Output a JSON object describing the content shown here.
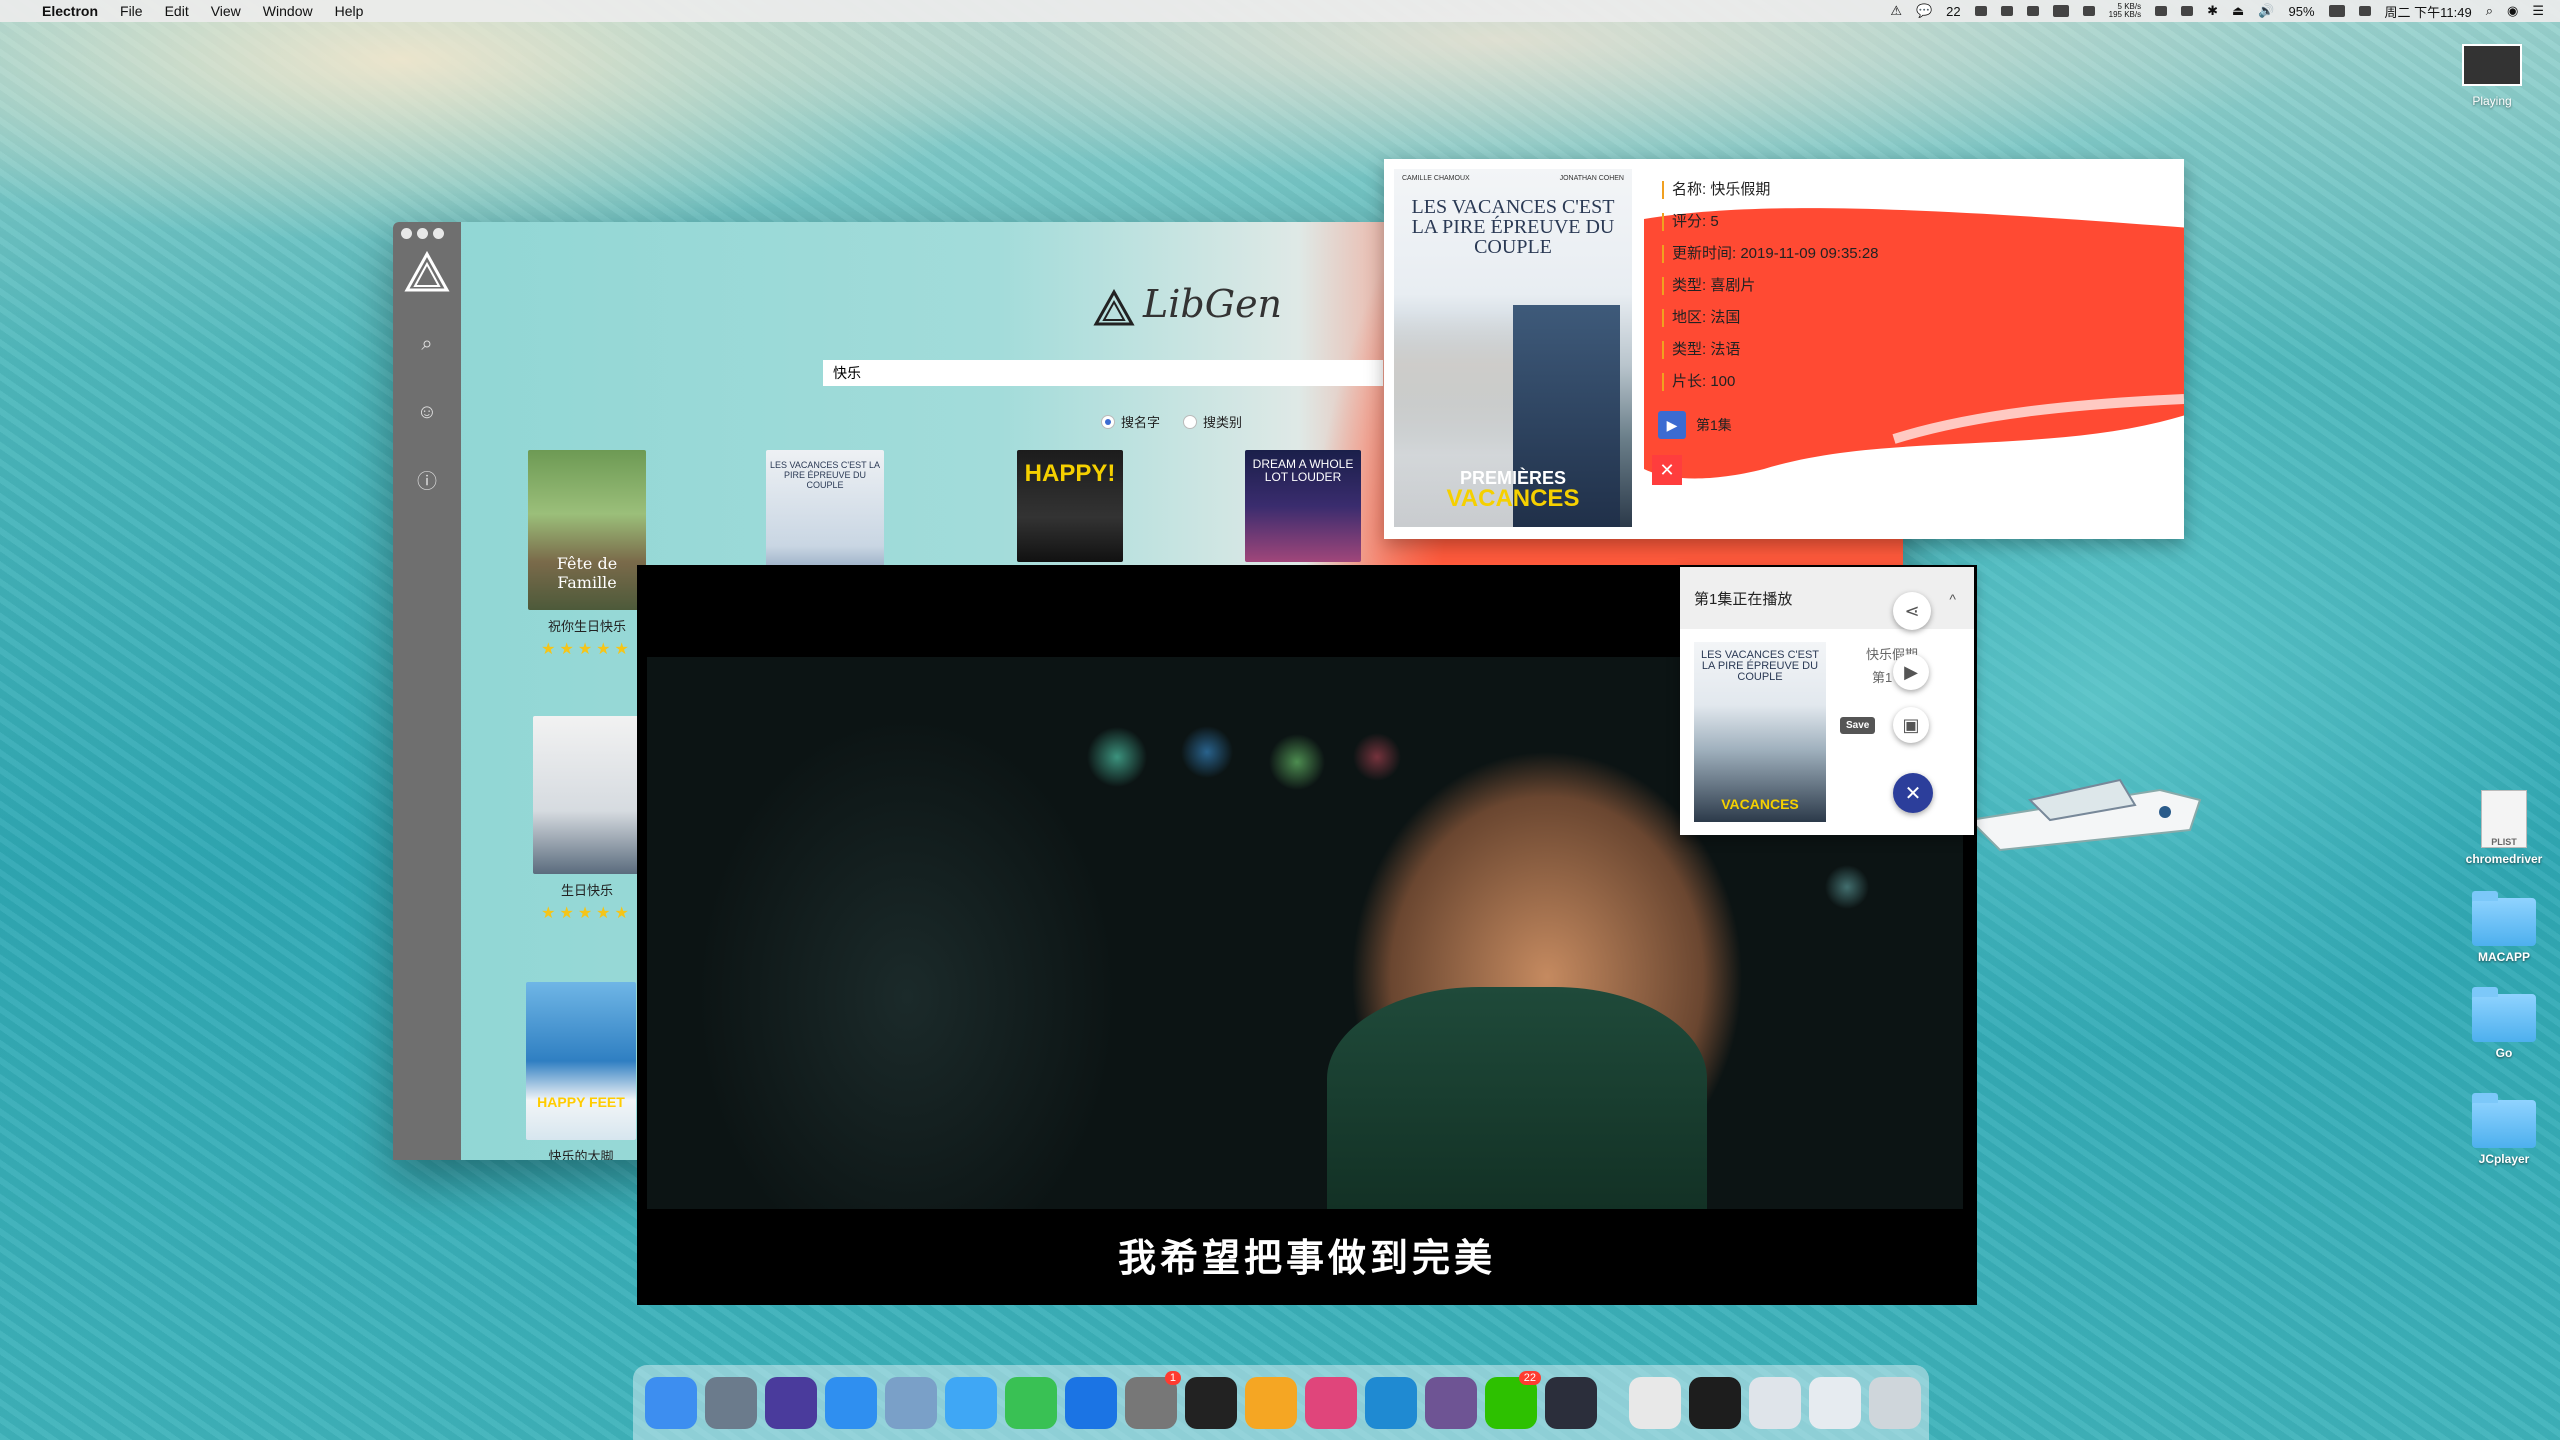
{
  "menubar": {
    "app_name": "Electron",
    "menus": [
      "File",
      "Edit",
      "View",
      "Window",
      "Help"
    ],
    "status": {
      "notif_count": "22",
      "net_up": "5 KB/s",
      "net_down": "195 KB/s",
      "battery": "95%",
      "clock": "周二 下午11:49"
    }
  },
  "desktop": {
    "playing_label": "Playing",
    "items": [
      {
        "label": "chromedriver",
        "type": "file",
        "badge": "PLIST"
      },
      {
        "label": "MACAPP",
        "type": "folder"
      },
      {
        "label": "Go",
        "type": "folder"
      },
      {
        "label": "JCplayer",
        "type": "folder"
      }
    ]
  },
  "libgen": {
    "logo_text": "LibGen",
    "search_value": "快乐",
    "radio_by_name": "搜名字",
    "radio_by_category": "搜类别",
    "cards": [
      {
        "title": "祝你生日快乐",
        "poster_text": "Fête de Famille",
        "stars": "★★★★★"
      },
      {
        "title": "",
        "poster_text": "LES VACANCES C'EST LA PIRE ÉPREUVE DU COUPLE",
        "stars": ""
      },
      {
        "title": "",
        "poster_text": "HAPPY!",
        "stars": ""
      },
      {
        "title": "",
        "poster_text": "DREAM A WHOLE LOT LOUDER",
        "stars": ""
      },
      {
        "title": "生日快乐",
        "poster_text": "",
        "stars": "★★★★★"
      },
      {
        "title": "快乐的大脚",
        "poster_text": "HAPPY FEET",
        "stars": ""
      }
    ]
  },
  "detail": {
    "poster_top_left": "CAMILLE CHAMOUX",
    "poster_top_right": "JONATHAN COHEN",
    "poster_title": "LES VACANCES C'EST LA PIRE ÉPREUVE DU COUPLE",
    "poster_bottom_1": "PREMIÈRES",
    "poster_bottom_2": "VACANCES",
    "name": "名称: 快乐假期",
    "rating": "评分: 5",
    "updated": "更新时间: 2019-11-09 09:35:28",
    "genre": "类型: 喜剧片",
    "region": "地区: 法国",
    "language": "类型: 法语",
    "duration": "片长: 100",
    "episode": "第1集",
    "close_symbol": "✕",
    "brush_color": "#ff4a33"
  },
  "player": {
    "subtitle": "我希望把事做到完美"
  },
  "now_playing": {
    "header": "第1集正在播放",
    "movie_name": "快乐假期",
    "episode": "第1",
    "save_tooltip": "Save",
    "collapse_symbol": "^",
    "close_symbol": "✕"
  },
  "dock": {
    "apps": [
      {
        "name": "finder",
        "color": "#3d8ef0"
      },
      {
        "name": "launchpad",
        "color": "#6b7b8c"
      },
      {
        "name": "siri",
        "color": "#4a3b9c"
      },
      {
        "name": "safari",
        "color": "#2f8ff0"
      },
      {
        "name": "preview",
        "color": "#7aa0c8"
      },
      {
        "name": "messages",
        "color": "#3fa7f5"
      },
      {
        "name": "facetime",
        "color": "#39c154"
      },
      {
        "name": "qq",
        "color": "#1b74e4"
      },
      {
        "name": "system-preferences",
        "color": "#777777",
        "badge": "1"
      },
      {
        "name": "terminal",
        "color": "#222222"
      },
      {
        "name": "photos",
        "color": "#f5a623"
      },
      {
        "name": "cleanmymac",
        "color": "#e0457b"
      },
      {
        "name": "vscode",
        "color": "#1f8ad2"
      },
      {
        "name": "github-desktop",
        "color": "#6e5494"
      },
      {
        "name": "wechat",
        "color": "#2dc100",
        "badge": "22"
      },
      {
        "name": "electron",
        "color": "#2b2e3b"
      }
    ],
    "recents": [
      {
        "name": "minimized-window-1",
        "color": "#e8e8e8"
      },
      {
        "name": "minimized-window-2",
        "color": "#1d1d1d"
      },
      {
        "name": "minimized-window-3",
        "color": "#dfe4ea"
      },
      {
        "name": "minimized-window-4",
        "color": "#e6ebf0"
      },
      {
        "name": "trash",
        "color": "#cfd6db"
      }
    ]
  }
}
